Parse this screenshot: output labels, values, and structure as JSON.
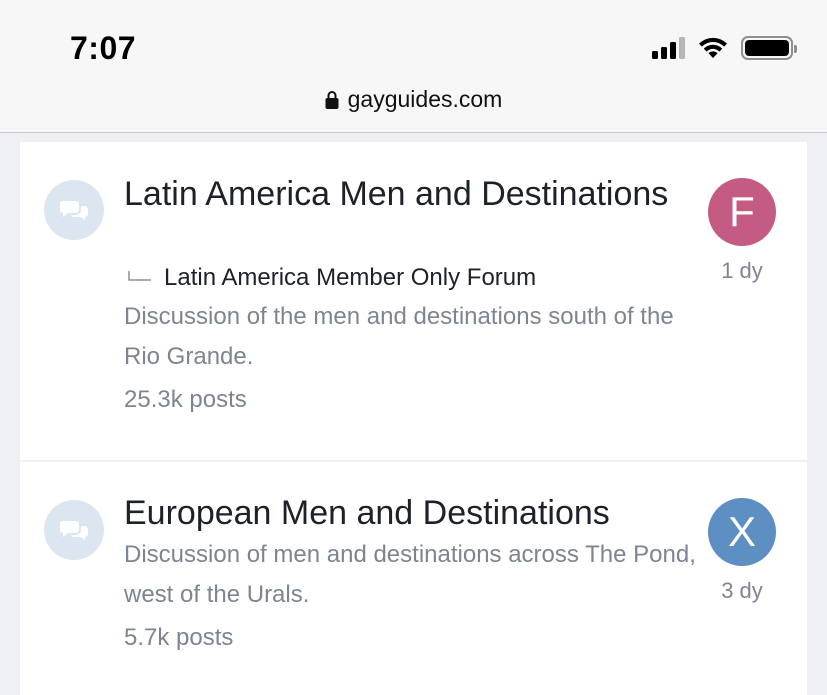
{
  "status_bar": {
    "time": "7:07",
    "icons": [
      "cellular-signal-icon",
      "wifi-icon",
      "battery-icon"
    ]
  },
  "browser": {
    "url": "gayguides.com",
    "lock_icon": "lock-icon"
  },
  "forums": [
    {
      "title": "Latin America Men and Destinations",
      "subforum": "Latin America Member Only Forum",
      "description": "Discussion of the men and destinations south of the Rio Grande.",
      "posts": "25.3k posts",
      "avatar_letter": "F",
      "avatar_color": "#c45b83",
      "last_activity": "1 dy"
    },
    {
      "title": "European Men and Destinations",
      "description": "Discussion of men and destinations across The Pond, west of the Urals.",
      "posts": "5.7k posts",
      "avatar_letter": "X",
      "avatar_color": "#5d8fc3",
      "last_activity": "3 dy"
    }
  ],
  "colors": {
    "page_background": "#eef0f3",
    "card_background": "#ffffff",
    "node_icon_background": "#dbe6f1",
    "node_icon_color": "#ffffff",
    "muted_text": "#7d8593"
  }
}
